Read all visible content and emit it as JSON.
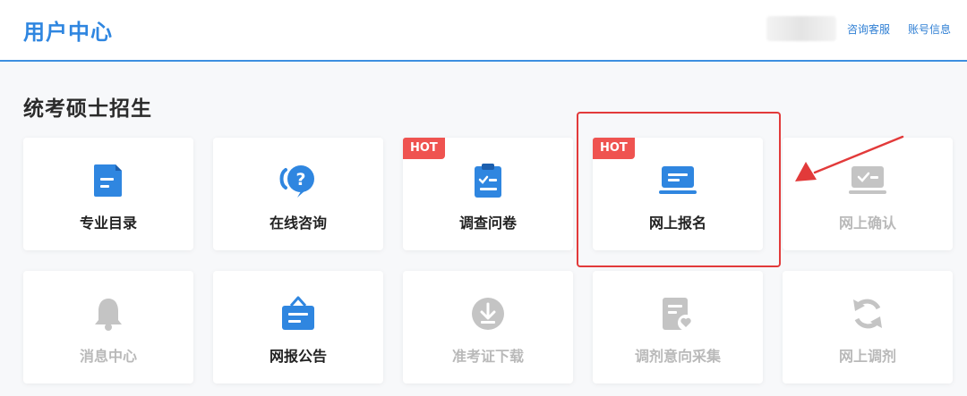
{
  "header": {
    "title": "用户中心",
    "links": [
      "咨询客服",
      "账号信息"
    ]
  },
  "section": {
    "title": "统考硕士招生"
  },
  "tiles": [
    {
      "label": "专业目录",
      "icon": "document-icon",
      "enabled": true,
      "hot": false
    },
    {
      "label": "在线咨询",
      "icon": "question-chat-icon",
      "enabled": true,
      "hot": false
    },
    {
      "label": "调查问卷",
      "icon": "clipboard-check-icon",
      "enabled": true,
      "hot": true
    },
    {
      "label": "网上报名",
      "icon": "laptop-form-icon",
      "enabled": true,
      "hot": true
    },
    {
      "label": "网上确认",
      "icon": "confirm-card-icon",
      "enabled": false,
      "hot": false
    },
    {
      "label": "消息中心",
      "icon": "bell-icon",
      "enabled": false,
      "hot": false
    },
    {
      "label": "网报公告",
      "icon": "notice-board-icon",
      "enabled": true,
      "hot": false
    },
    {
      "label": "准考证下载",
      "icon": "download-icon",
      "enabled": false,
      "hot": false
    },
    {
      "label": "调剂意向采集",
      "icon": "document-heart-icon",
      "enabled": false,
      "hot": false
    },
    {
      "label": "网上调剂",
      "icon": "refresh-icon",
      "enabled": false,
      "hot": false
    }
  ],
  "badges": {
    "hot": "HOT"
  },
  "colors": {
    "accent": "#2f86e0",
    "hot": "#ef5350",
    "highlight": "#e23a3a",
    "disabled": "#c4c4c4"
  }
}
